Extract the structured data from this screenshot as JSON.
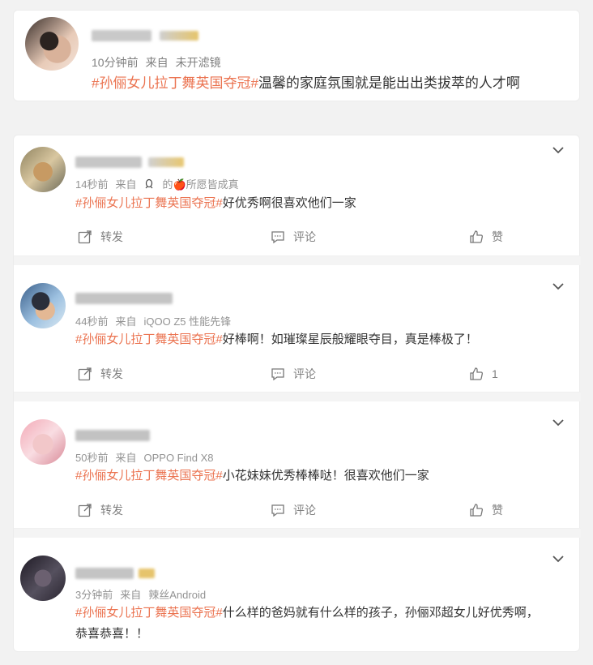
{
  "top_post": {
    "time": "10分钟前",
    "from": "来自",
    "source": "未开滤镜",
    "tag": "#孙俪女儿拉丁舞英国夺冠#",
    "body": "温馨的家庭氛围就是能出出类拔萃的人才啊"
  },
  "comments": [
    {
      "time": "14秒前",
      "from": "来自",
      "source": "的🍎所愿皆成真",
      "tag": "#孙俪女儿拉丁舞英国夺冠#",
      "body": "好优秀啊很喜欢他们一家",
      "forward_label": "转发",
      "comment_label": "评论",
      "like_label": "赞"
    },
    {
      "time": "44秒前",
      "from": "来自",
      "source": "iQOO Z5 性能先锋",
      "tag": "#孙俪女儿拉丁舞英国夺冠#",
      "body": "好棒啊！如璀璨星辰般耀眼夺目，真是棒极了！",
      "forward_label": "转发",
      "comment_label": "评论",
      "like_label": "1"
    },
    {
      "time": "50秒前",
      "from": "来自",
      "source": "OPPO Find X8",
      "tag": "#孙俪女儿拉丁舞英国夺冠#",
      "body": "小花妹妹优秀棒棒哒！很喜欢他们一家",
      "forward_label": "转发",
      "comment_label": "评论",
      "like_label": "赞"
    },
    {
      "time": "3分钟前",
      "from": "来自",
      "source": "辣丝Android",
      "tag": "#孙俪女儿拉丁舞英国夺冠#",
      "body": "什么样的爸妈就有什么样的孩子，孙俪邓超女儿好优秀啊，",
      "body2": "恭喜恭喜！！"
    }
  ],
  "colors": {
    "tag": "#eb7350",
    "meta": "#939393",
    "action": "#808080"
  }
}
